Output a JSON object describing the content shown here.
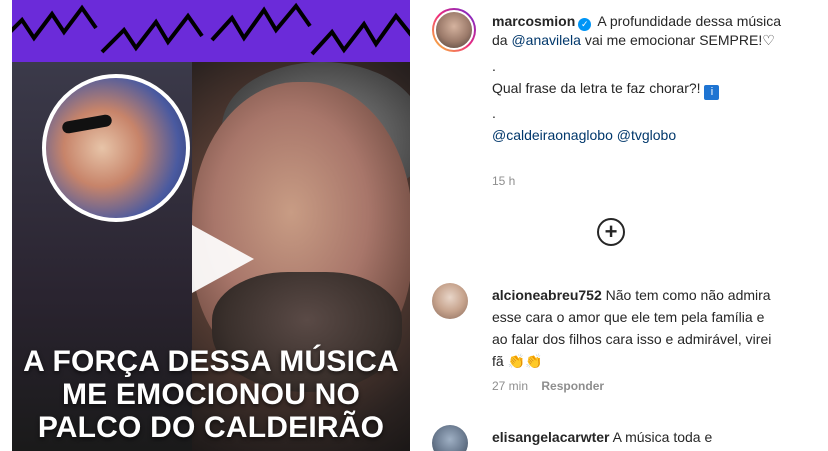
{
  "media": {
    "caption_lines": [
      "A FORÇA DESSA MÚSICA",
      "ME EMOCIONOU NO",
      "PALCO DO CALDEIRÃO"
    ]
  },
  "post": {
    "username": "marcosmion",
    "caption_intro": "A profundidade dessa",
    "caption_line2_pre": "música da",
    "caption_mention": "@anavilela",
    "caption_line2_post": "vai me",
    "caption_line3": "emocionar SEMPRE!♡",
    "dot1": ".",
    "question": "Qual frase da letra te faz chorar?!",
    "dot2": ".",
    "mention_1": "@caldeiraonaglobo",
    "mention_2": "@tvglobo",
    "time": "15 h"
  },
  "comments": [
    {
      "username": "alcioneabreu752",
      "text": "Não tem como não admira esse cara o amor que ele tem pela família e ao falar dos filhos cara isso e admirável, virei fã 👏👏",
      "time": "27 min",
      "reply_label": "Responder"
    },
    {
      "username": "elisangelacarwter",
      "text": "A música toda e"
    }
  ],
  "icons": {
    "verified": "verified-badge-icon",
    "info": "info-icon",
    "load_more": "plus-circle-icon",
    "play": "play-icon"
  },
  "colors": {
    "banner": "#6b2bd9",
    "mention": "#00376b",
    "verified": "#0095f6",
    "meta": "#8e8e8e"
  }
}
